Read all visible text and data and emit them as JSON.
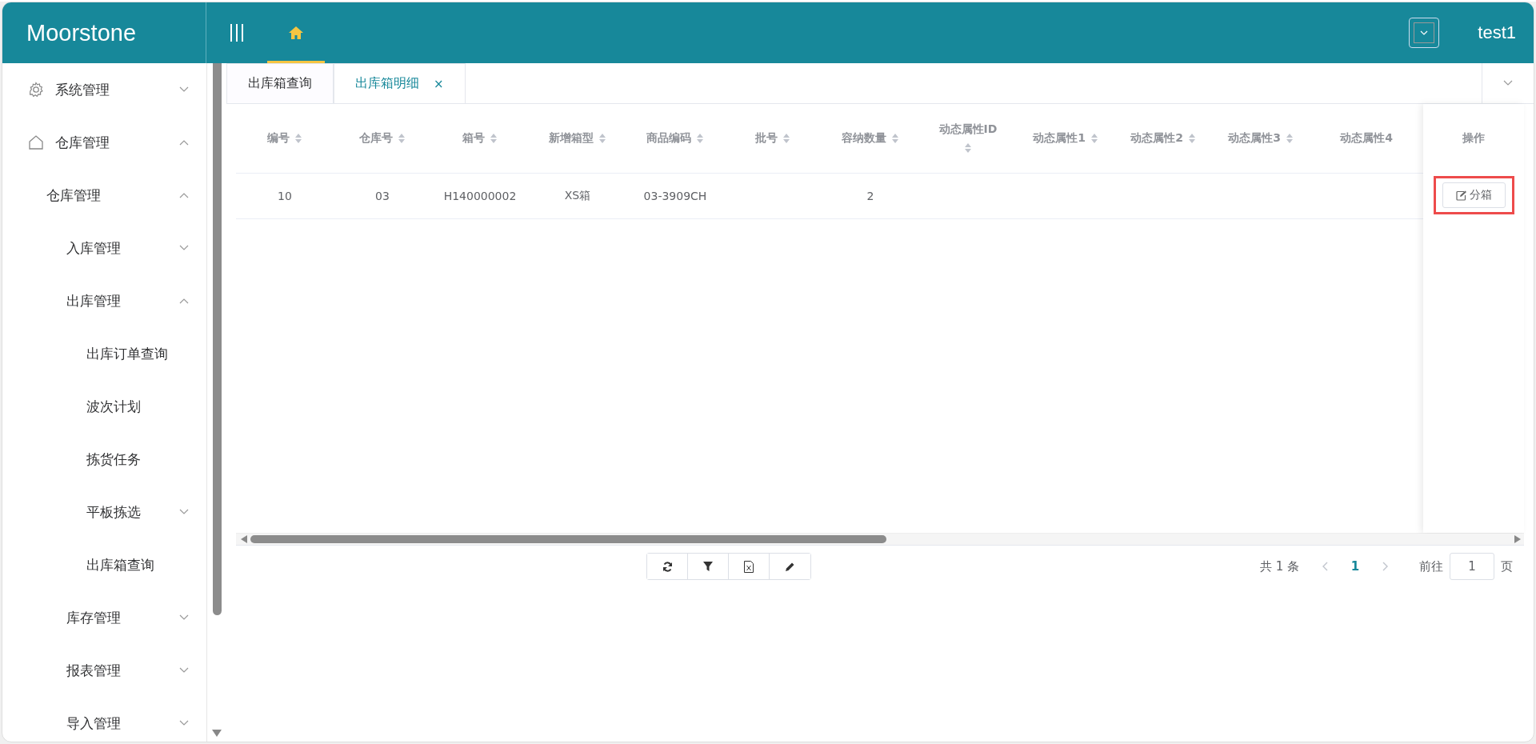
{
  "header": {
    "logo": "Moorstone",
    "nav_tabs": [
      {
        "kind": "home",
        "selected": true
      }
    ],
    "user": "test1"
  },
  "sidebar": {
    "items": [
      {
        "label": "系统管理",
        "kind": "submenu",
        "expanded": false
      },
      {
        "label": "仓库管理",
        "kind": "submenu",
        "expanded": true,
        "children": [
          {
            "label": "仓库管理",
            "kind": "submenu",
            "expanded": true,
            "children": [
              {
                "label": "入库管理",
                "kind": "submenu",
                "expanded": false
              },
              {
                "label": "出库管理",
                "kind": "submenu",
                "expanded": true,
                "children": [
                  {
                    "label": "出库订单查询",
                    "kind": "item"
                  },
                  {
                    "label": "波次计划",
                    "kind": "item"
                  },
                  {
                    "label": "拣货任务",
                    "kind": "item"
                  },
                  {
                    "label": "平板拣选",
                    "kind": "submenu",
                    "expanded": false
                  },
                  {
                    "label": "出库箱查询",
                    "kind": "item"
                  }
                ]
              },
              {
                "label": "库存管理",
                "kind": "submenu",
                "expanded": false
              },
              {
                "label": "报表管理",
                "kind": "submenu",
                "expanded": false
              },
              {
                "label": "导入管理",
                "kind": "submenu",
                "expanded": false
              }
            ]
          }
        ]
      }
    ]
  },
  "tabs": [
    {
      "label": "出库箱查询",
      "selected": false,
      "closable": false
    },
    {
      "label": "出库箱明细",
      "selected": true,
      "closable": true,
      "close": "×"
    }
  ],
  "table": {
    "columns": [
      {
        "label": "编号",
        "sortable": true
      },
      {
        "label": "仓库号",
        "sortable": true
      },
      {
        "label": "箱号",
        "sortable": true
      },
      {
        "label": "新增箱型",
        "sortable": true
      },
      {
        "label": "商品编码",
        "sortable": true
      },
      {
        "label": "批号",
        "sortable": true
      },
      {
        "label": "容纳数量",
        "sortable": true
      },
      {
        "label": "动态属性ID",
        "sortable": true
      },
      {
        "label": "动态属性1",
        "sortable": true
      },
      {
        "label": "动态属性2",
        "sortable": true
      },
      {
        "label": "动态属性3",
        "sortable": true
      },
      {
        "label": "动态属性4",
        "sortable": false
      }
    ],
    "action_column": {
      "label": "操作"
    },
    "rows": [
      {
        "cells": [
          "10",
          "03",
          "H140000002",
          "XS箱",
          "03-3909CH",
          "",
          "2",
          "",
          "",
          "",
          "",
          ""
        ],
        "action": {
          "label": "分箱",
          "highlighted": true
        }
      }
    ]
  },
  "pagination": {
    "total": "共 1 条",
    "pages": [
      {
        "label": "1",
        "selected": true
      }
    ],
    "goto_label": "前往",
    "goto_value": "1",
    "goto_suffix": "页"
  }
}
